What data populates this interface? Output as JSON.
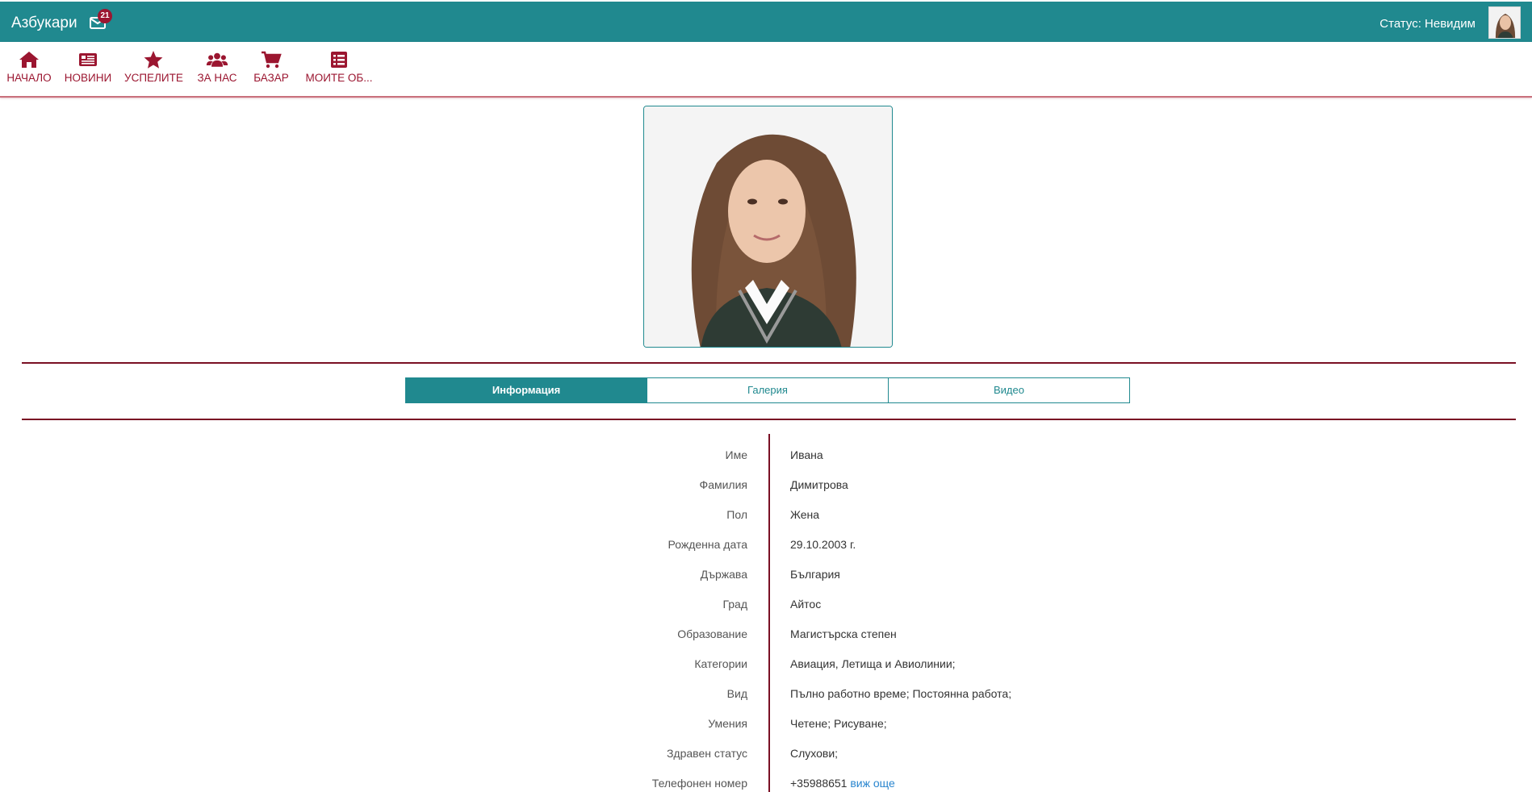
{
  "header": {
    "brand": "Азбукари",
    "mail_count": "21",
    "status": "Статус: Невидим"
  },
  "nav": [
    {
      "label": "НАЧАЛО",
      "icon": "home-icon"
    },
    {
      "label": "НОВИНИ",
      "icon": "newspaper-icon"
    },
    {
      "label": "УСПЕЛИТЕ",
      "icon": "star-icon"
    },
    {
      "label": "ЗА НАС",
      "icon": "users-icon"
    },
    {
      "label": "БАЗАР",
      "icon": "cart-icon"
    },
    {
      "label": "МОИТЕ ОБ...",
      "icon": "list-icon"
    }
  ],
  "tabs": [
    "Информация",
    "Галерия",
    "Видео"
  ],
  "profile": {
    "rows": [
      {
        "label": "Име",
        "value": "Ивана"
      },
      {
        "label": "Фамилия",
        "value": "Димитрова"
      },
      {
        "label": "Пол",
        "value": "Жена"
      },
      {
        "label": "Рожденна дата",
        "value": "29.10.2003 г."
      },
      {
        "label": "Държава",
        "value": "България"
      },
      {
        "label": "Град",
        "value": "Айтос"
      },
      {
        "label": "Образование",
        "value": "Магистърска степен"
      },
      {
        "label": "Категории",
        "value": "Авиация, Летища и Авиолинии;"
      },
      {
        "label": "Вид",
        "value": "Пълно работно време; Постоянна работа;"
      },
      {
        "label": "Умения",
        "value": "Четене; Рисуване;"
      },
      {
        "label": "Здравен статус",
        "value": "Слухови;"
      },
      {
        "label": "Телефонен номер",
        "value": "+35988651",
        "more": "виж още"
      }
    ]
  },
  "colors": {
    "teal": "#20898f",
    "crimson": "#9b1630",
    "link": "#2a86cf"
  }
}
